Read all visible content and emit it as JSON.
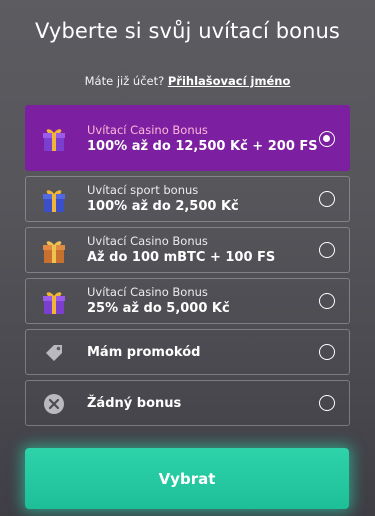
{
  "header": {
    "title": "Vyberte si svůj uvítací bonus",
    "account_question": "Máte již účet?",
    "login_link": "Přihlašovací jméno"
  },
  "options": [
    {
      "line1": "Uvítací Casino Bonus",
      "line2": "100% až do 12,500 Kč + 200 FS",
      "icon": "gift-purple-icon",
      "selected": true
    },
    {
      "line1": "Uvítací sport bonus",
      "line2": "100% až do 2,500 Kč",
      "icon": "gift-blue-icon",
      "selected": false
    },
    {
      "line1": "Uvítací Casino Bonus",
      "line2": "Až do 100 mBTC + 100 FS",
      "icon": "gift-orange-icon",
      "selected": false
    },
    {
      "line1": "Uvítací Casino Bonus",
      "line2": "25% až do 5,000 Kč",
      "icon": "gift-purple-icon",
      "selected": false
    },
    {
      "line1": "",
      "line2": "Mám promokód",
      "icon": "tag-icon",
      "selected": false
    },
    {
      "line1": "",
      "line2": "Žádný bonus",
      "icon": "close-circle-icon",
      "selected": false
    }
  ],
  "submit_label": "Vybrat",
  "colors": {
    "selected_bg": "#7c1fa0",
    "selected_subtitle": "#ffb8da",
    "cta": "#22c9a0"
  }
}
